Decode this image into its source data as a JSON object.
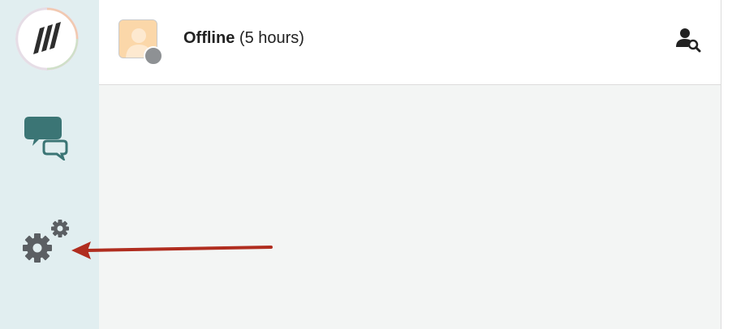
{
  "header": {
    "status": "Offline",
    "duration": "(5 hours)"
  },
  "icons": {
    "logo": "app-logo",
    "chat": "chat-bubbles-icon",
    "settings": "gears-icon",
    "user_search": "user-search-icon",
    "status": "offline-status-dot"
  },
  "colors": {
    "sidebar": "#e1eef0",
    "accent_teal": "#3b7575",
    "gear": "#5b5f63",
    "arrow": "#b02d1f",
    "offline": "#8e9194"
  }
}
